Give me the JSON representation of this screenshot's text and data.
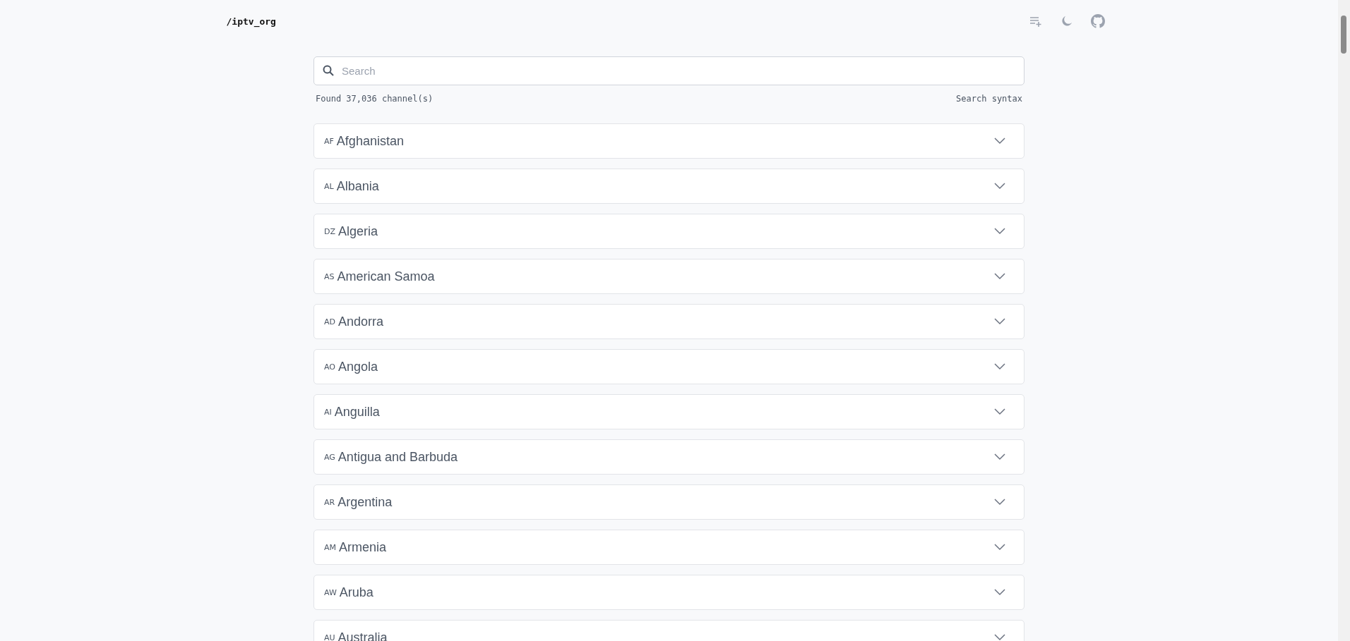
{
  "header": {
    "logo": "/iptv_org"
  },
  "search": {
    "placeholder": "Search"
  },
  "results": {
    "count": "Found 37,036 channel(s)",
    "syntax_link": "Search syntax"
  },
  "countries": [
    {
      "code": "AF",
      "name": "Afghanistan",
      "expanded": false
    },
    {
      "code": "AL",
      "name": "Albania",
      "expanded": false
    },
    {
      "code": "DZ",
      "name": "Algeria",
      "expanded": false
    },
    {
      "code": "AS",
      "name": "American Samoa",
      "expanded": false
    },
    {
      "code": "AD",
      "name": "Andorra",
      "expanded": false
    },
    {
      "code": "AO",
      "name": "Angola",
      "expanded": false
    },
    {
      "code": "AI",
      "name": "Anguilla",
      "expanded": false
    },
    {
      "code": "AG",
      "name": "Antigua and Barbuda",
      "expanded": false
    },
    {
      "code": "AR",
      "name": "Argentina",
      "expanded": false
    },
    {
      "code": "AM",
      "name": "Armenia",
      "expanded": false
    },
    {
      "code": "AW",
      "name": "Aruba",
      "expanded": false
    },
    {
      "code": "AU",
      "name": "Australia",
      "expanded": false
    }
  ]
}
